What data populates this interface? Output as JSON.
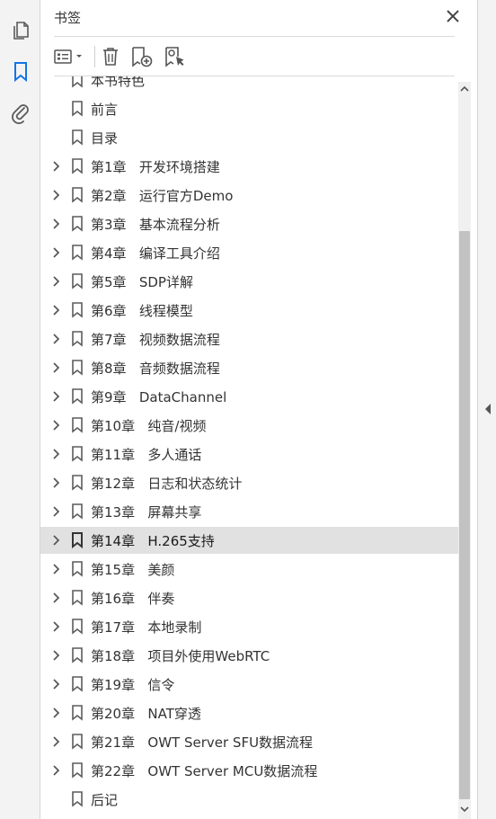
{
  "panel": {
    "title": "书签",
    "accent_color": "#1473e6"
  },
  "left_rail": {
    "icons": [
      "pages-icon",
      "bookmark-icon",
      "attachment-icon"
    ]
  },
  "toolbar": {
    "icons": [
      "options-menu-icon",
      "delete-bookmark-icon",
      "new-bookmark-icon",
      "find-bookmark-icon"
    ]
  },
  "bookmarks": [
    {
      "label": "本书特色",
      "expandable": false,
      "partial": true
    },
    {
      "label": "前言",
      "expandable": false
    },
    {
      "label": "目录",
      "expandable": false
    },
    {
      "label": "第1章   开发环境搭建",
      "expandable": true
    },
    {
      "label": "第2章   运行官方Demo",
      "expandable": true
    },
    {
      "label": "第3章   基本流程分析",
      "expandable": true
    },
    {
      "label": "第4章   编译工具介绍",
      "expandable": true
    },
    {
      "label": "第5章   SDP详解",
      "expandable": true
    },
    {
      "label": "第6章   线程模型",
      "expandable": true
    },
    {
      "label": "第7章   视频数据流程",
      "expandable": true
    },
    {
      "label": "第8章   音频数据流程",
      "expandable": true
    },
    {
      "label": "第9章   DataChannel",
      "expandable": true
    },
    {
      "label": "第10章   纯音/视频",
      "expandable": true
    },
    {
      "label": "第11章   多人通话",
      "expandable": true
    },
    {
      "label": "第12章   日志和状态统计",
      "expandable": true
    },
    {
      "label": "第13章   屏幕共享",
      "expandable": true
    },
    {
      "label": "第14章   H.265支持",
      "expandable": true,
      "selected": true
    },
    {
      "label": "第15章   美颜",
      "expandable": true
    },
    {
      "label": "第16章   伴奏",
      "expandable": true
    },
    {
      "label": "第17章   本地录制",
      "expandable": true
    },
    {
      "label": "第18章   项目外使用WebRTC",
      "expandable": true
    },
    {
      "label": "第19章   信令",
      "expandable": true
    },
    {
      "label": "第20章   NAT穿透",
      "expandable": true
    },
    {
      "label": "第21章   OWT Server SFU数据流程",
      "expandable": true
    },
    {
      "label": "第22章   OWT Server MCU数据流程",
      "expandable": true
    },
    {
      "label": "后记",
      "expandable": false
    }
  ]
}
